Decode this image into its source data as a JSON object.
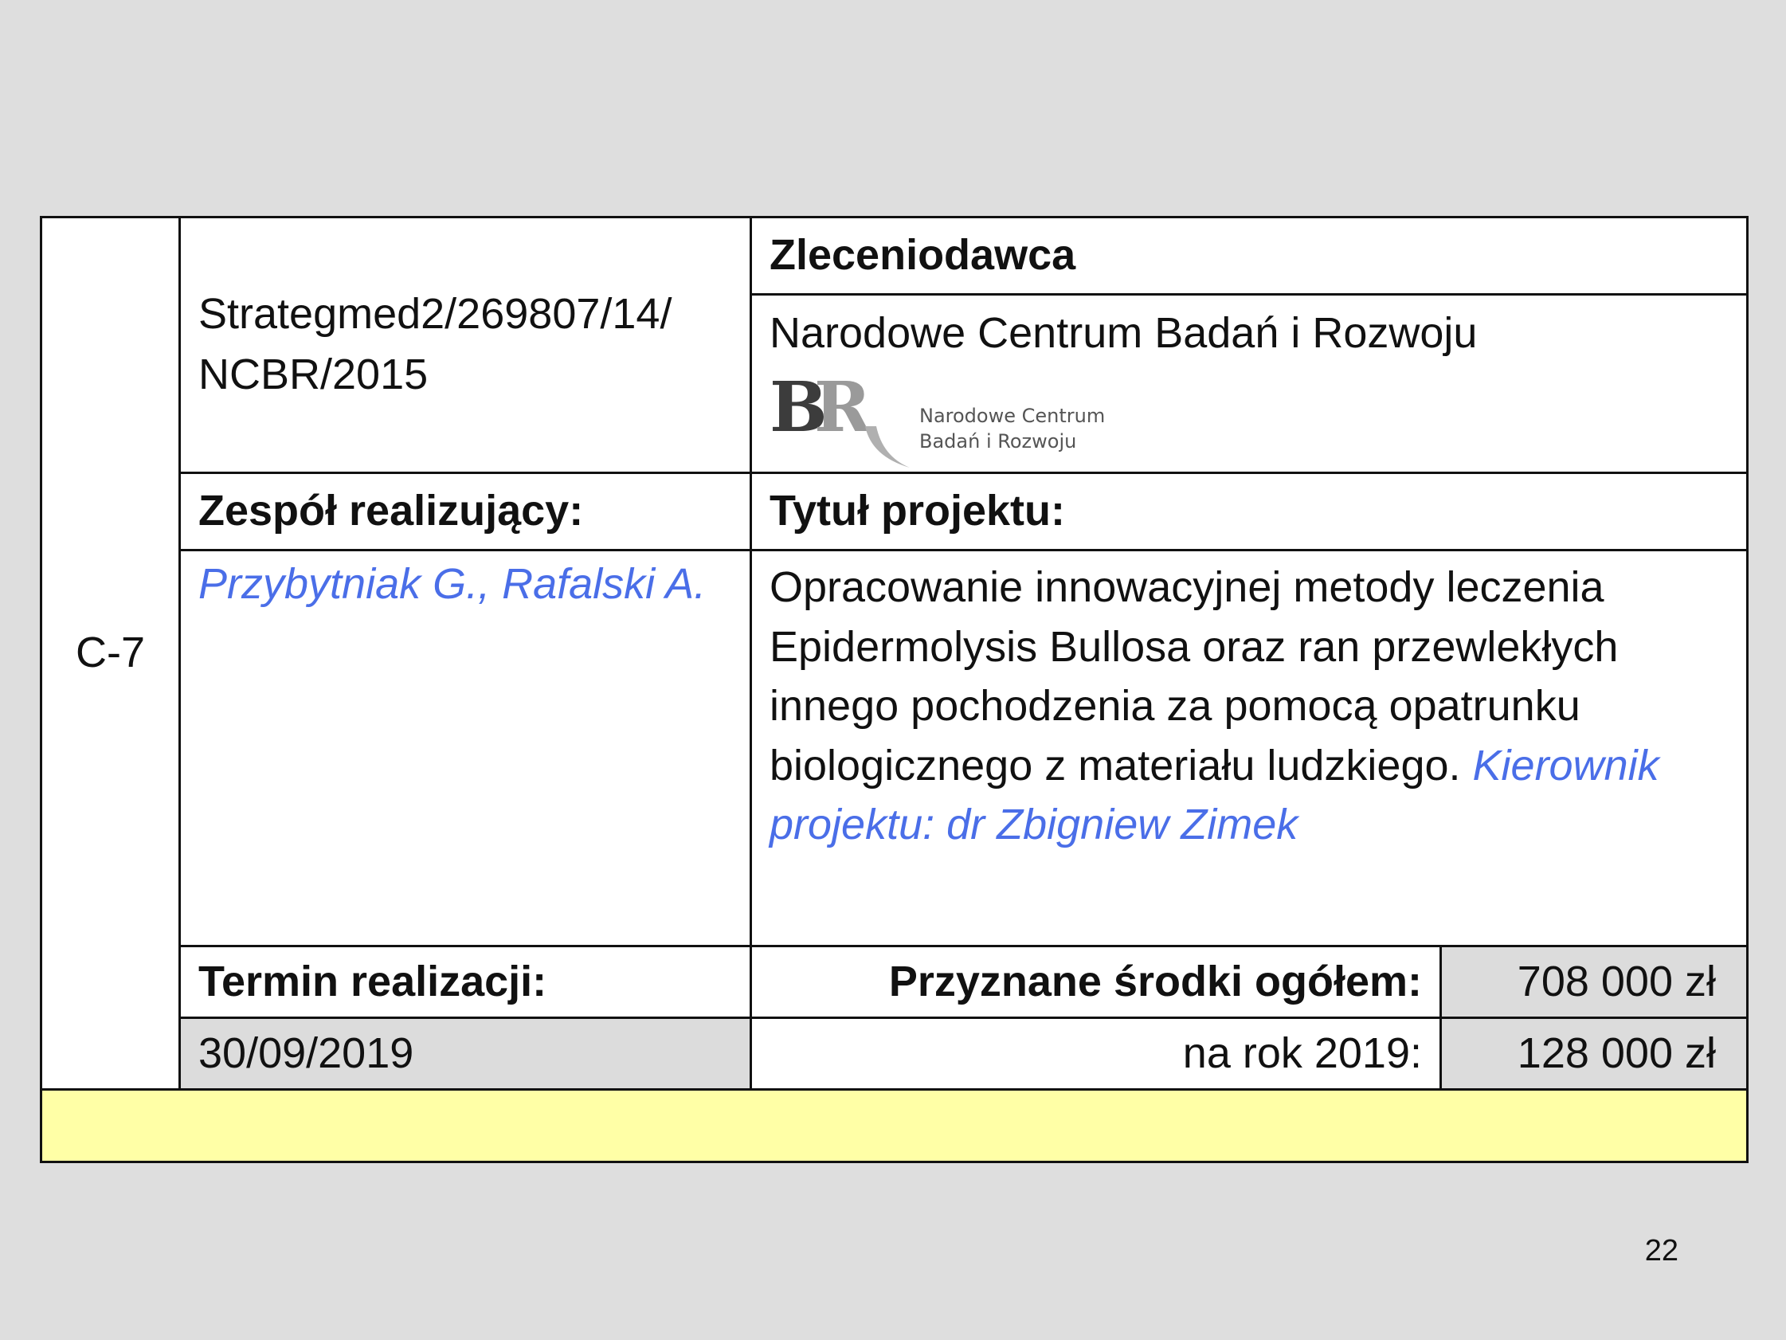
{
  "row_id": "C-7",
  "contract_number_line1": "Strategmed2/269807/14/",
  "contract_number_line2": "NCBR/2015",
  "client": {
    "header": "Zleceniodawca",
    "name": "Narodowe Centrum Badań i Rozwoju",
    "logo": {
      "mark": "BR",
      "text_line1": "Narodowe Centrum",
      "text_line2": "Badań i Rozwoju",
      "colors": {
        "dark": "#3c3c3c",
        "light": "#9a9a9a"
      }
    }
  },
  "team": {
    "header": "Zespół realizujący:",
    "members": "Przybytniak G., Rafalski A."
  },
  "project": {
    "header": "Tytuł projektu:",
    "title": "Opracowanie innowacyjnej metody leczenia Epidermolysis Bullosa oraz ran przewlekłych innego pochodzenia za pomocą opatrunku biologicznego z materiału ludzkiego.",
    "manager": "Kierownik projektu: dr Zbigniew Zimek"
  },
  "deadline": {
    "header": "Termin realizacji:",
    "date": "30/09/2019"
  },
  "funds": {
    "total_label": "Przyznane środki ogółem:",
    "total_value": "708 000 zł",
    "year_label": "na rok 2019:",
    "year_value": "128 000 zł"
  },
  "page_number": "22",
  "colors": {
    "accent_blue": "#4a6ee8",
    "gray_cell": "#dcdcdc",
    "yellow_row": "#ffffa6",
    "background": "#dedede"
  }
}
